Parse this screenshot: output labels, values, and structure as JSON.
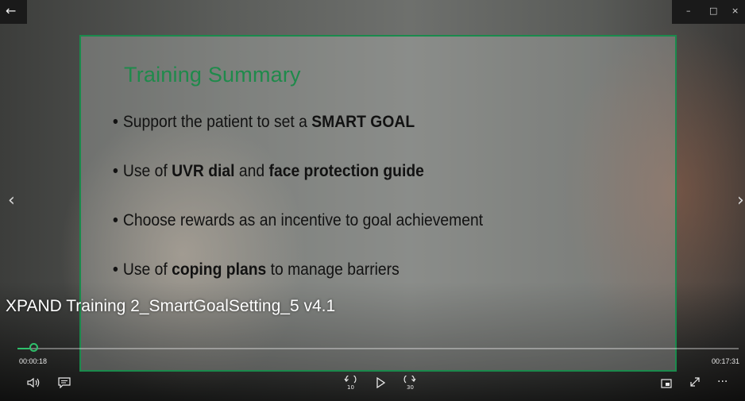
{
  "window": {
    "back_icon": "arrow-left-icon",
    "controls": {
      "minimize": "–",
      "maximize": "□",
      "close": "×"
    }
  },
  "slide": {
    "title": "Training Summary",
    "bullets": [
      {
        "parts": [
          {
            "text": "Support the patient to set a ",
            "bold": false
          },
          {
            "text": "SMART GOAL",
            "bold": true
          }
        ]
      },
      {
        "parts": [
          {
            "text": "Use of ",
            "bold": false
          },
          {
            "text": "UVR dial",
            "bold": true
          },
          {
            "text": " and ",
            "bold": false
          },
          {
            "text": "face protection guide",
            "bold": true
          }
        ]
      },
      {
        "parts": [
          {
            "text": "Choose rewards as an incentive to goal achievement",
            "bold": false
          }
        ]
      },
      {
        "parts": [
          {
            "text": "Use of ",
            "bold": false
          },
          {
            "text": "coping plans",
            "bold": true
          },
          {
            "text": " to manage barriers",
            "bold": false
          }
        ]
      }
    ],
    "accent_color": "#1f8a4b"
  },
  "video": {
    "title": "XPAND Training 2_SmartGoalSetting_5 v4.1",
    "elapsed": "00:00:18",
    "total": "00:17:31",
    "progress_fraction": 0.017,
    "progress_color": "#2fbf6b"
  },
  "controls": {
    "skip_back_seconds": "10",
    "skip_forward_seconds": "30",
    "icons": [
      "volume-icon",
      "captions-icon",
      "skip-back-icon",
      "play-icon",
      "skip-forward-icon",
      "mini-view-icon",
      "fullscreen-icon",
      "more-options-icon"
    ]
  },
  "nav": {
    "prev_icon": "chevron-left-icon",
    "next_icon": "chevron-right-icon"
  }
}
